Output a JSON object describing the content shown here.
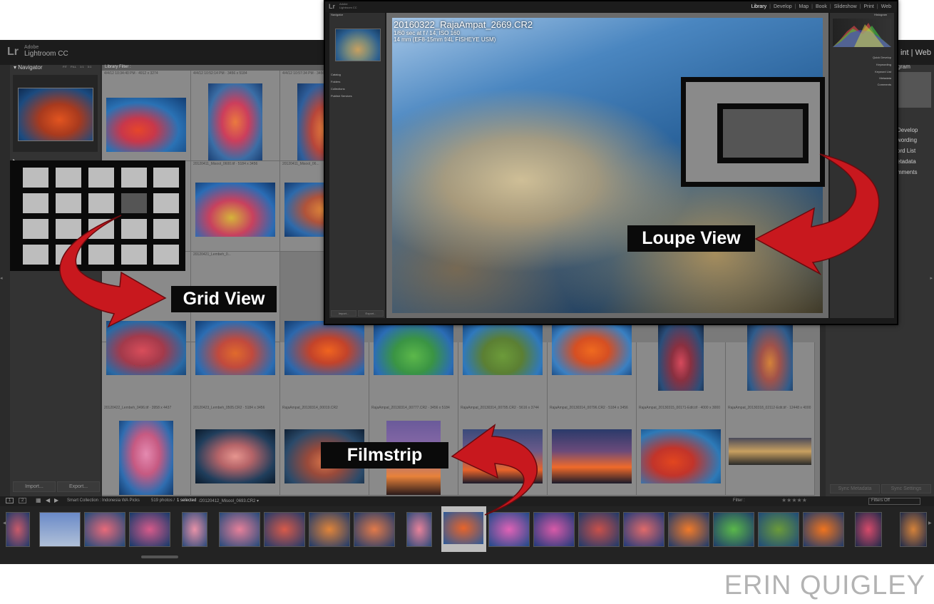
{
  "lightroom": {
    "logo": "Lr",
    "brand": "Adobe",
    "app_name": "Lightroom CC",
    "top_right_visible": "int | Web",
    "navigator": {
      "title": "Navigator",
      "zoom_options": [
        "FIT",
        "FILL",
        "1:1",
        "3:1"
      ]
    },
    "library_filter": "Library Filter :",
    "left_buttons": {
      "import": "Import...",
      "export": "Export..."
    },
    "right_panel_items": [
      "Histogram",
      "Quick Develop",
      "Keywording",
      "Keyword List",
      "Metadata",
      "Comments"
    ],
    "right_panel_visible": [
      "togram",
      "Develop",
      "wording",
      "ord List",
      "etadata",
      "mments"
    ],
    "right_buttons": {
      "sync_meta": "Sync Metadata",
      "sync_settings": "Sync Settings"
    }
  },
  "grid": {
    "rows": [
      [
        {
          "meta": "4/4/12 10:34:40 PM · 4912 x 3274"
        },
        {
          "meta": "4/4/12 10:52:14 PM · 3456 x 5184"
        },
        {
          "meta": "4/4/12 10:57:34 PM · 3456 x 5184"
        }
      ],
      [
        {
          "meta": ""
        },
        {
          "meta": "20120411_Misool_0600.tif · 5184 x 3456"
        },
        {
          "meta": "20120411_Misool_06..."
        }
      ],
      [
        {
          "meta": ""
        },
        {
          "meta": "20120421_Lembeh_0..."
        },
        {
          "meta": ""
        }
      ],
      [
        {
          "meta": "20120422_Lembeh_0496.tif · 3958 x 4437"
        },
        {
          "meta": "20120423_Lembeh_0505.CR2 · 5184 x 3456"
        },
        {
          "meta": "RajaAmpat_20130314_00019.CR2"
        },
        {
          "meta": "RajaAmpat_20130314_00777.CR2 · 3456 x 5184"
        },
        {
          "meta": "RajaAmpat_20130314_00795.CR2 · 5616 x 3744"
        },
        {
          "meta": "RajaAmpat_20130314_00796.CR2 · 5184 x 3456"
        },
        {
          "meta": "RajaAmpat_20130315_00171-Edit.tif · 4000 x 3000"
        },
        {
          "meta": "RajaAmpat_20130318_02112-Edit.tif · 12448 x 4000"
        }
      ]
    ]
  },
  "filmstrip": {
    "pages": [
      "1",
      "2"
    ],
    "source": "Smart Collection : Indonesia WA Picks",
    "count": "519 photos /",
    "selected": "1 selected",
    "file": "/20120412_Misool_0693.CR2 ▾",
    "filter_label": "Filter :",
    "filters_off": "Filters Off",
    "stars": "★★★★★"
  },
  "loupe_window": {
    "module_nav": [
      "Library",
      "Develop",
      "Map",
      "Book",
      "Slideshow",
      "Print",
      "Web"
    ],
    "filename": "20160322_RajaAmpat_2669.CR2",
    "exposure": "1/60 sec at f / 14, ISO 160",
    "lens": "14 mm (EF8-15mm f/4L FISHEYE USM)",
    "left_sections": [
      "Navigator",
      "Catalog",
      "Folders",
      "Collections",
      "Publish Services"
    ],
    "right_sections": [
      "Histogram",
      "Quick Develop",
      "Keywording",
      "Keyword List",
      "Metadata",
      "Comments"
    ]
  },
  "callouts": {
    "grid": "Grid View",
    "loupe": "Loupe View",
    "filmstrip": "Filmstrip"
  },
  "watermark": "ERIN QUIGLEY",
  "colors": {
    "arrow": "#c8181e",
    "callout_bg": "#0a0a0a",
    "panel": "#333333",
    "grid_bg": "#7a7a7a"
  }
}
